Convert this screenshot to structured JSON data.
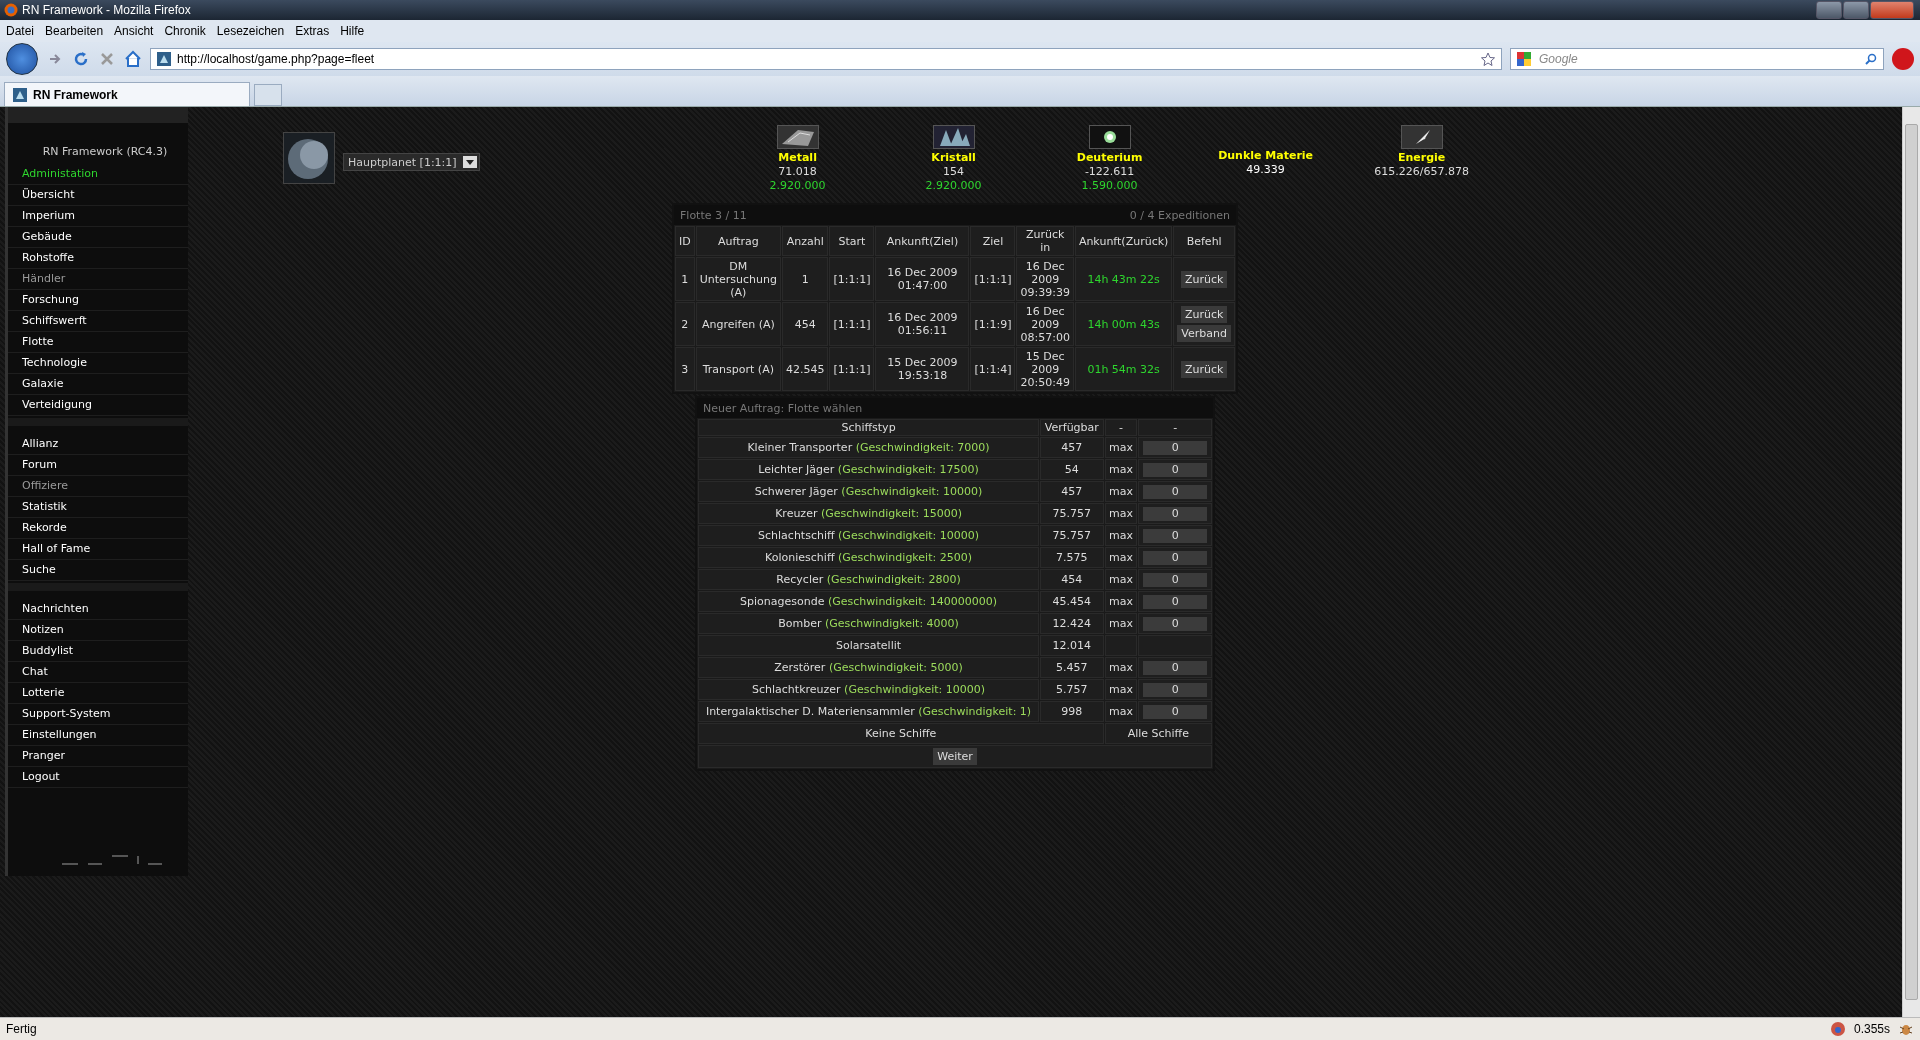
{
  "window": {
    "title": "RN Framework - Mozilla Firefox"
  },
  "menu": [
    "Datei",
    "Bearbeiten",
    "Ansicht",
    "Chronik",
    "Lesezeichen",
    "Extras",
    "Hilfe"
  ],
  "address": {
    "value": "http://localhost/game.php?page=fleet"
  },
  "search": {
    "placeholder": "Google"
  },
  "tabs": [
    {
      "label": "RN Framework",
      "selected": true
    }
  ],
  "sidebar": {
    "title": "RN Framework (RC4.3)",
    "admin_link": "Administation",
    "groups": [
      {
        "items": [
          {
            "label": "Übersicht",
            "disabled": false
          },
          {
            "label": "Imperium",
            "disabled": false
          },
          {
            "label": "Gebäude",
            "disabled": false
          },
          {
            "label": "Rohstoffe",
            "disabled": false
          },
          {
            "label": "Händler",
            "disabled": true
          },
          {
            "label": "Forschung",
            "disabled": false
          },
          {
            "label": "Schiffswerft",
            "disabled": false
          },
          {
            "label": "Flotte",
            "disabled": false
          },
          {
            "label": "Technologie",
            "disabled": false
          },
          {
            "label": "Galaxie",
            "disabled": false
          },
          {
            "label": "Verteidigung",
            "disabled": false
          }
        ]
      },
      {
        "items": [
          {
            "label": "Allianz",
            "disabled": false
          },
          {
            "label": "Forum",
            "disabled": false
          },
          {
            "label": "Offiziere",
            "disabled": true
          },
          {
            "label": "Statistik",
            "disabled": false
          },
          {
            "label": "Rekorde",
            "disabled": false
          },
          {
            "label": "Hall of Fame",
            "disabled": false
          },
          {
            "label": "Suche",
            "disabled": false
          }
        ]
      },
      {
        "items": [
          {
            "label": "Nachrichten",
            "disabled": false
          },
          {
            "label": "Notizen",
            "disabled": false
          },
          {
            "label": "Buddylist",
            "disabled": false
          },
          {
            "label": "Chat",
            "disabled": false
          },
          {
            "label": "Lotterie",
            "disabled": false
          },
          {
            "label": "Support-System",
            "disabled": false
          },
          {
            "label": "Einstellungen",
            "disabled": false
          },
          {
            "label": "Pranger",
            "disabled": false
          },
          {
            "label": "Logout",
            "disabled": false
          }
        ]
      }
    ]
  },
  "planet": {
    "value": "Hauptplanet [1:1:1]"
  },
  "resources": [
    {
      "kind": "metal",
      "name": "Metall",
      "amount": "71.018",
      "production": "2.920.000"
    },
    {
      "kind": "crystal",
      "name": "Kristall",
      "amount": "154",
      "production": "2.920.000"
    },
    {
      "kind": "deuterium",
      "name": "Deuterium",
      "amount": "-122.611",
      "production": "1.590.000"
    },
    {
      "kind": "darkmatter",
      "name": "Dunkle Materie",
      "amount": "49.339"
    },
    {
      "kind": "energy",
      "name": "Energie",
      "amount": "615.226/657.878"
    }
  ],
  "fleet": {
    "title": "Flotte 3 / 11",
    "expeditions": "0 / 4 Expeditionen",
    "columns": [
      "ID",
      "Auftrag",
      "Anzahl",
      "Start",
      "Ankunft(Ziel)",
      "Ziel",
      "Zurück in",
      "Ankunft(Zurück)",
      "Befehl"
    ],
    "rows": [
      {
        "id": "1",
        "mission": "DM Untersuchung (A)",
        "count": "1",
        "start": "[1:1:1]",
        "arrival": "16 Dec 2009 01:47:00",
        "target": "[1:1:1]",
        "return": "16 Dec 2009 09:39:39",
        "remaining": "14h 43m 22s",
        "commands": [
          "Zurück"
        ]
      },
      {
        "id": "2",
        "mission": "Angreifen (A)",
        "count": "454",
        "start": "[1:1:1]",
        "arrival": "16 Dec 2009 01:56:11",
        "target": "[1:1:9]",
        "return": "16 Dec 2009 08:57:00",
        "remaining": "14h 00m 43s",
        "commands": [
          "Zurück",
          "Verband"
        ]
      },
      {
        "id": "3",
        "mission": "Transport (A)",
        "count": "42.545",
        "start": "[1:1:1]",
        "arrival": "15 Dec 2009 19:53:18",
        "target": "[1:1:4]",
        "return": "15 Dec 2009 20:50:49",
        "remaining": "01h 54m 32s",
        "commands": [
          "Zurück"
        ]
      }
    ]
  },
  "new_order": {
    "title": "Neuer Auftrag: Flotte wählen",
    "columns": [
      "Schiffstyp",
      "Verfügbar",
      "-",
      "-"
    ],
    "ships": [
      {
        "name": "Kleiner Transporter",
        "speed": "(Geschwindigkeit: 7000)",
        "available": "457",
        "max": "max",
        "amount": "0"
      },
      {
        "name": "Leichter Jäger",
        "speed": "(Geschwindigkeit: 17500)",
        "available": "54",
        "max": "max",
        "amount": "0"
      },
      {
        "name": "Schwerer Jäger",
        "speed": "(Geschwindigkeit: 10000)",
        "available": "457",
        "max": "max",
        "amount": "0"
      },
      {
        "name": "Kreuzer",
        "speed": "(Geschwindigkeit: 15000)",
        "available": "75.757",
        "max": "max",
        "amount": "0"
      },
      {
        "name": "Schlachtschiff",
        "speed": "(Geschwindigkeit: 10000)",
        "available": "75.757",
        "max": "max",
        "amount": "0"
      },
      {
        "name": "Kolonieschiff",
        "speed": "(Geschwindigkeit: 2500)",
        "available": "7.575",
        "max": "max",
        "amount": "0"
      },
      {
        "name": "Recycler",
        "speed": "(Geschwindigkeit: 2800)",
        "available": "454",
        "max": "max",
        "amount": "0"
      },
      {
        "name": "Spionagesonde",
        "speed": "(Geschwindigkeit: 140000000)",
        "available": "45.454",
        "max": "max",
        "amount": "0"
      },
      {
        "name": "Bomber",
        "speed": "(Geschwindigkeit: 4000)",
        "available": "12.424",
        "max": "max",
        "amount": "0"
      },
      {
        "name": "Solarsatellit",
        "available": "12.014"
      },
      {
        "name": "Zerstörer",
        "speed": "(Geschwindigkeit: 5000)",
        "available": "5.457",
        "max": "max",
        "amount": "0"
      },
      {
        "name": "Schlachtkreuzer",
        "speed": "(Geschwindigkeit: 10000)",
        "available": "5.757",
        "max": "max",
        "amount": "0"
      },
      {
        "name": "Intergalaktischer D. Materiensammler",
        "speed": "(Geschwindigkeit: 1)",
        "available": "998",
        "max": "max",
        "amount": "0"
      }
    ],
    "no_ships": "Keine Schiffe",
    "all_ships": "Alle Schiffe",
    "next_button": "Weiter"
  },
  "status_bar": {
    "text": "Fertig",
    "timing": "0.355s"
  }
}
